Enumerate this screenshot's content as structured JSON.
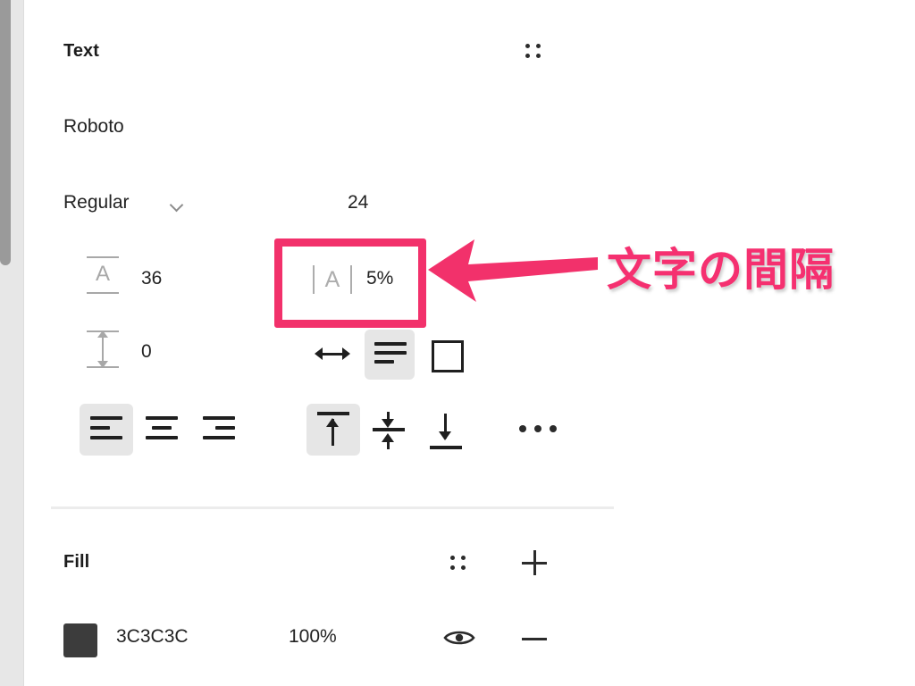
{
  "window": {
    "background_color": "#ffffff",
    "scrollbar": {
      "track_color": "#e7e7e7",
      "thumb_color": "#9a9a9a"
    }
  },
  "text_section": {
    "title": "Text",
    "style_icon": "four-dots-icon",
    "font_family": "Roboto",
    "font_weight": "Regular",
    "font_weight_chevron": "chevron-down-icon",
    "font_size": "24",
    "line_height_icon": "line-height-icon",
    "line_height": "36",
    "letter_spacing_icon": "letter-spacing-icon",
    "letter_spacing_glyph": "A",
    "letter_spacing": "5%",
    "paragraph_spacing_icon": "paragraph-spacing-icon",
    "paragraph_spacing": "0",
    "resize_options": [
      {
        "name": "auto-width",
        "icon": "horizontal-resize-icon",
        "selected": false
      },
      {
        "name": "auto-height",
        "icon": "auto-height-icon",
        "selected": true
      },
      {
        "name": "fixed-size",
        "icon": "fixed-size-square-icon",
        "selected": false
      }
    ],
    "horizontal_align": [
      {
        "name": "align-left",
        "icon": "align-left-icon",
        "selected": true
      },
      {
        "name": "align-center",
        "icon": "align-center-icon",
        "selected": false
      },
      {
        "name": "align-right",
        "icon": "align-right-icon",
        "selected": false
      }
    ],
    "vertical_align": [
      {
        "name": "align-top",
        "icon": "align-top-icon",
        "selected": true
      },
      {
        "name": "align-middle",
        "icon": "align-middle-icon",
        "selected": false
      },
      {
        "name": "align-bottom",
        "icon": "align-bottom-icon",
        "selected": false
      }
    ],
    "more_options_icon": "ellipsis-icon"
  },
  "fill_section": {
    "title": "Fill",
    "style_icon": "four-dots-icon",
    "add_icon": "plus-icon",
    "swatch_color": "#3C3C3C",
    "color_hex": "3C3C3C",
    "opacity": "100%",
    "visibility_icon": "eye-icon",
    "remove_icon": "minus-icon"
  },
  "annotation": {
    "label": "文字の間隔",
    "accent_color": "#f53070",
    "box_color": "#f2316b",
    "arrow_icon": "left-arrow-annotation",
    "highlight_target": "letter-spacing-field"
  }
}
